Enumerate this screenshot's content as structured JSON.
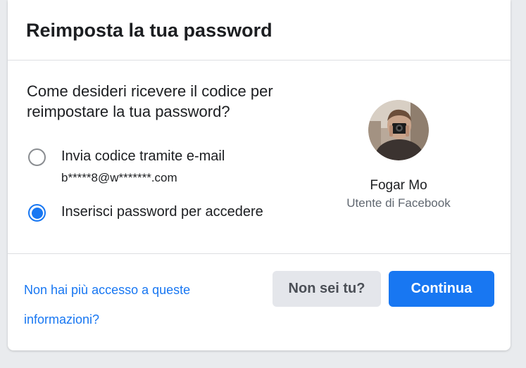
{
  "dialog": {
    "title": "Reimposta la tua password"
  },
  "body": {
    "question": "Come desideri ricevere il codice per reimpostare la tua password?",
    "options": [
      {
        "label": "Invia codice tramite e-mail",
        "detail": "b*****8@w*******.com",
        "selected": false
      },
      {
        "label": "Inserisci password per accedere",
        "selected": true
      }
    ]
  },
  "profile": {
    "name": "Fogar Mo",
    "subtitle": "Utente di Facebook"
  },
  "footer": {
    "help_link": "Non hai più accesso a queste informazioni?",
    "not_you_button": "Non sei tu?",
    "continue_button": "Continua"
  },
  "colors": {
    "accent": "#1877f2",
    "secondary_button_bg": "#e4e6eb",
    "text": "#1c1e21",
    "muted_text": "#606770",
    "background": "#e9ebee"
  }
}
